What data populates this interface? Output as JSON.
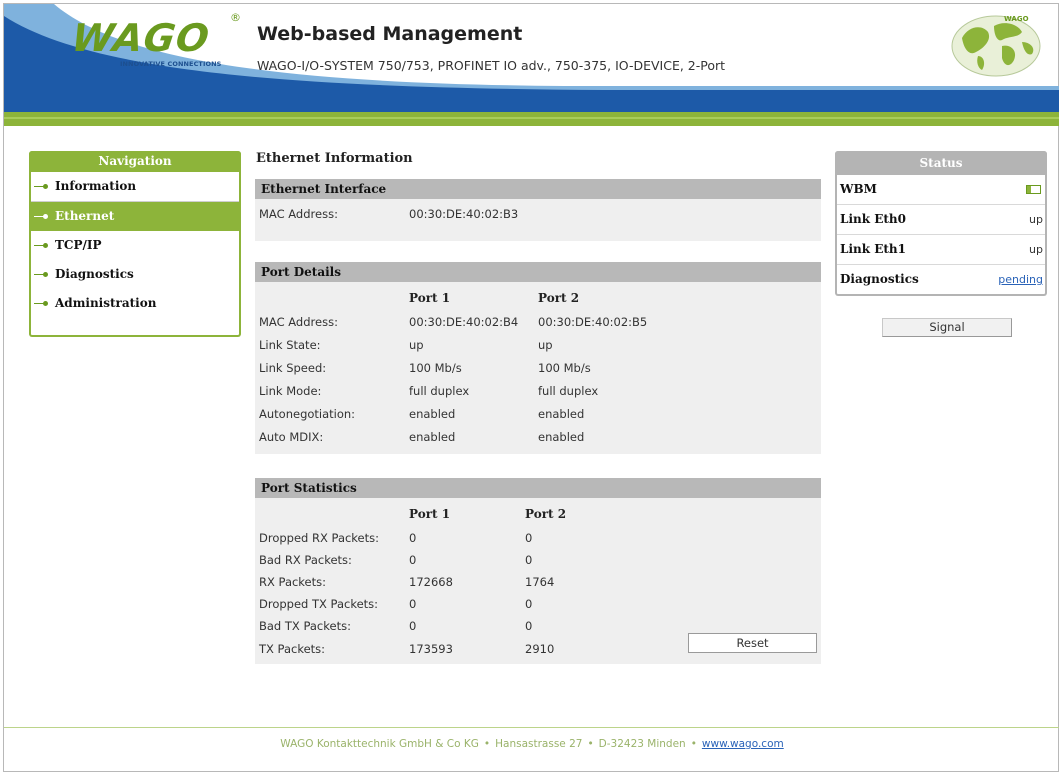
{
  "header": {
    "logo_text": "WAGO",
    "logo_tagline": "INNOVATIVE CONNECTIONS",
    "title": "Web-based Management",
    "subtitle": "WAGO-I/O-SYSTEM 750/753, PROFINET IO adv., 750-375, IO-DEVICE, 2-Port",
    "globe_label": "WAGO",
    "colors": {
      "green": "#8db43a",
      "blue": "#1d5aa8"
    }
  },
  "navigation": {
    "title": "Navigation",
    "items": [
      {
        "label": "Information",
        "active": false
      },
      {
        "label": "Ethernet",
        "active": true
      },
      {
        "label": "TCP/IP",
        "active": false
      },
      {
        "label": "Diagnostics",
        "active": false
      },
      {
        "label": "Administration",
        "active": false
      }
    ]
  },
  "main": {
    "title": "Ethernet Information",
    "ethernet_interface": {
      "heading": "Ethernet Interface",
      "label": "MAC Address:",
      "value": "00:30:DE:40:02:B3"
    },
    "port_details": {
      "heading": "Port Details",
      "columns": [
        "Port 1",
        "Port 2"
      ],
      "rows": [
        {
          "label": "MAC Address:",
          "port1": "00:30:DE:40:02:B4",
          "port2": "00:30:DE:40:02:B5"
        },
        {
          "label": "Link State:",
          "port1": "up",
          "port2": "up"
        },
        {
          "label": "Link Speed:",
          "port1": "100 Mb/s",
          "port2": "100 Mb/s"
        },
        {
          "label": "Link Mode:",
          "port1": "full duplex",
          "port2": "full duplex"
        },
        {
          "label": "Autonegotiation:",
          "port1": "enabled",
          "port2": "enabled"
        },
        {
          "label": "Auto MDIX:",
          "port1": "enabled",
          "port2": "enabled"
        }
      ]
    },
    "port_statistics": {
      "heading": "Port Statistics",
      "columns": [
        "Port 1",
        "Port 2"
      ],
      "rows": [
        {
          "label": "Dropped RX Packets:",
          "port1": "0",
          "port2": "0"
        },
        {
          "label": "Bad RX Packets:",
          "port1": "0",
          "port2": "0"
        },
        {
          "label": "RX Packets:",
          "port1": "172668",
          "port2": "1764"
        },
        {
          "label": "Dropped TX Packets:",
          "port1": "0",
          "port2": "0"
        },
        {
          "label": "Bad TX Packets:",
          "port1": "0",
          "port2": "0"
        },
        {
          "label": "TX Packets:",
          "port1": "173593",
          "port2": "2910"
        }
      ],
      "reset_label": "Reset"
    }
  },
  "status": {
    "title": "Status",
    "rows": [
      {
        "label": "WBM",
        "value": ""
      },
      {
        "label": "Link Eth0",
        "value": "up"
      },
      {
        "label": "Link Eth1",
        "value": "up"
      },
      {
        "label": "Diagnostics",
        "value": "pending"
      }
    ],
    "signal_label": "Signal"
  },
  "footer": {
    "company": "WAGO Kontakttechnik GmbH & Co KG",
    "address": "Hansastrasse 27",
    "city": "D-32423 Minden",
    "website": "www.wago.com"
  }
}
